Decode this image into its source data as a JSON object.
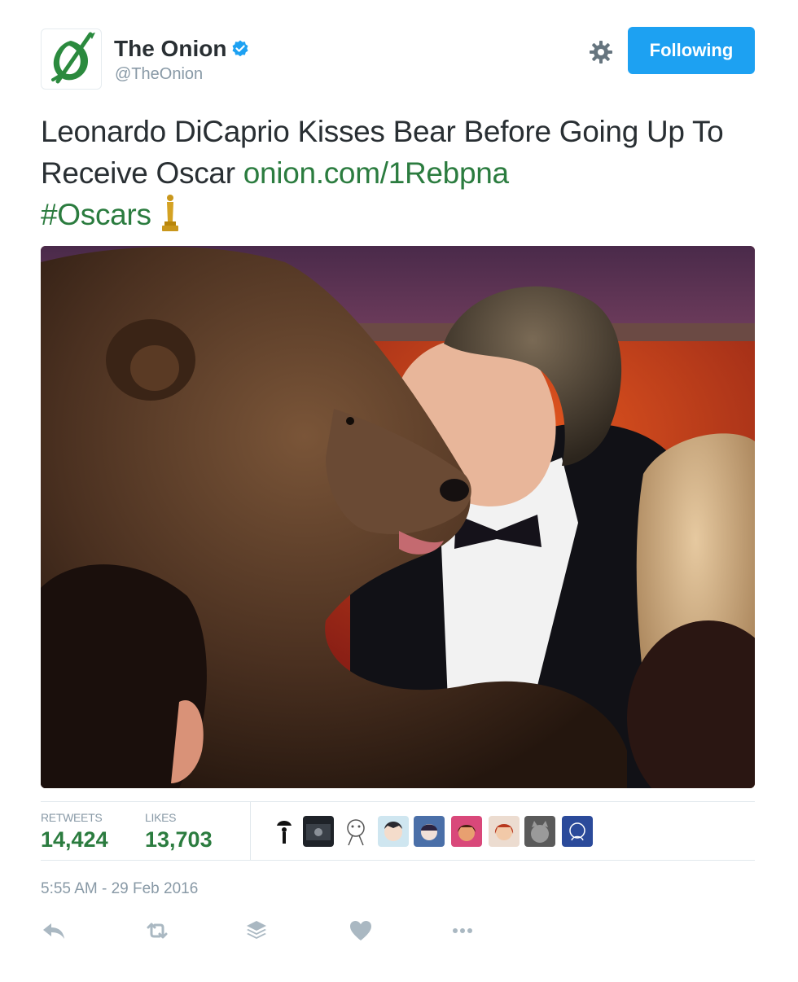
{
  "author": {
    "display_name": "The Onion",
    "handle": "@TheOnion",
    "verified_icon": "verified-badge-icon",
    "avatar_icon": "onion-logo-icon",
    "brand_color": "#2b7c3f"
  },
  "header": {
    "follow_label": "Following",
    "settings_icon": "gear-icon"
  },
  "tweet": {
    "text": "Leonardo DiCaprio Kisses Bear Before Going Up To Receive Oscar",
    "link": "onion.com/1Rebpna",
    "hashtag": "#Oscars",
    "emoji_icon": "oscar-statuette-icon",
    "photo_alt": "Leonardo DiCaprio kissing a bear"
  },
  "stats": {
    "retweets_label": "RETWEETS",
    "retweets_value": "14,424",
    "likes_label": "LIKES",
    "likes_value": "13,703"
  },
  "likers": [
    {
      "icon": "umbrella-silhouette-avatar"
    },
    {
      "icon": "photo-avatar"
    },
    {
      "icon": "meme-face-avatar"
    },
    {
      "icon": "anime-avatar"
    },
    {
      "icon": "cartoon-avatar"
    },
    {
      "icon": "selfie-avatar"
    },
    {
      "icon": "redhead-avatar"
    },
    {
      "icon": "cat-avatar"
    },
    {
      "icon": "sketch-avatar"
    }
  ],
  "timestamp": "5:55 AM - 29 Feb 2016",
  "actions": [
    {
      "icon": "reply-icon"
    },
    {
      "icon": "retweet-icon"
    },
    {
      "icon": "buffer-stack-icon"
    },
    {
      "icon": "heart-icon"
    },
    {
      "icon": "more-dots-icon"
    }
  ],
  "colors": {
    "accent": "#1da1f2",
    "text": "#292f33",
    "muted": "#8899a6"
  }
}
